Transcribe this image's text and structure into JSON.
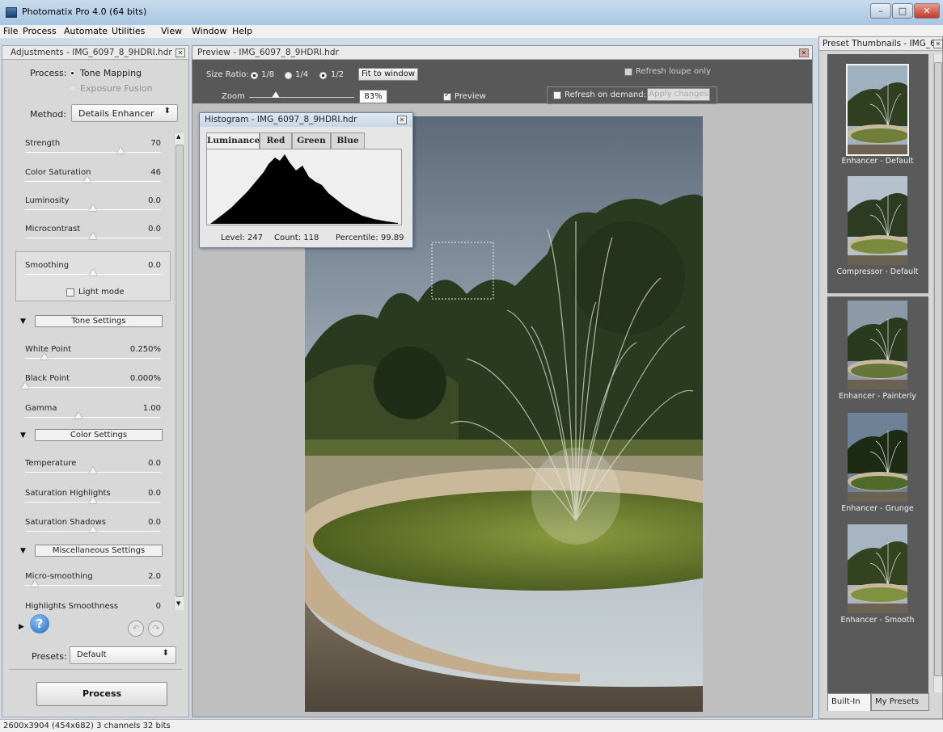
{
  "window": {
    "title": "Photomatix Pro 4.0 (64 bits)",
    "controls": [
      "–",
      "□",
      "✕"
    ]
  },
  "menu": [
    "File",
    "Process",
    "Automate",
    "Utilities",
    "View",
    "Window",
    "Help"
  ],
  "adjustments": {
    "header": "Adjustments - IMG_6097_8_9HDRI.hdr",
    "process_label": "Process:",
    "process_options": [
      "Tone Mapping",
      "Exposure Fusion"
    ],
    "method_label": "Method:",
    "method_value": "Details Enhancer",
    "sliders": [
      {
        "label": "Strength",
        "value": "70",
        "level": 0.7
      },
      {
        "label": "Color Saturation",
        "value": "46",
        "level": 0.46
      },
      {
        "label": "Luminosity",
        "value": "0.0",
        "level": 0.5
      },
      {
        "label": "Microcontrast",
        "value": "0.0",
        "level": 0.5
      },
      {
        "label": "Smoothing",
        "value": "0.0",
        "level": 0.5
      }
    ],
    "light_mode": "Light mode",
    "sections": {
      "tone": {
        "title": "Tone Settings",
        "sliders": [
          {
            "label": "White Point",
            "value": "0.250%",
            "level": 0.14
          },
          {
            "label": "Black Point",
            "value": "0.000%",
            "level": 0.0
          },
          {
            "label": "Gamma",
            "value": "1.00",
            "level": 0.39
          }
        ]
      },
      "color": {
        "title": "Color Settings",
        "sliders": [
          {
            "label": "Temperature",
            "value": "0.0",
            "level": 0.5
          },
          {
            "label": "Saturation Highlights",
            "value": "0.0",
            "level": 0.5
          },
          {
            "label": "Saturation Shadows",
            "value": "0.0",
            "level": 0.5
          }
        ]
      },
      "misc": {
        "title": "Miscellaneous Settings",
        "sliders": [
          {
            "label": "Micro-smoothing",
            "value": "2.0",
            "level": 0.07
          },
          {
            "label": "Highlights Smoothness",
            "value": "0",
            "level": 0.0
          }
        ]
      }
    },
    "presets_label": "Presets:",
    "presets_value": "Default",
    "process_button": "Process"
  },
  "preview": {
    "header": "Preview - IMG_6097_8_9HDRI.hdr",
    "size_ratio_label": "Size Ratio:",
    "size_ratios": [
      "1/8",
      "1/4",
      "1/2"
    ],
    "fit_to_window": "Fit to window",
    "zoom_label": "Zoom",
    "zoom_value": "83%",
    "zoom_level": 0.25,
    "preview_label": "Preview",
    "refresh_loupe": "Refresh loupe only",
    "refresh_on_demand": "Refresh on demand:",
    "apply_changes": "Apply changes"
  },
  "histogram": {
    "title": "Histogram - IMG_6097_8_9HDRI.hdr",
    "tabs": [
      "Luminance",
      "Red",
      "Green",
      "Blue"
    ],
    "level": "Level: 247",
    "count": "Count: 118",
    "percentile": "Percentile: 99.89"
  },
  "presets_panel": {
    "header": "Preset Thumbnails - IMG_6...",
    "thumbs": [
      "Enhancer - Default",
      "Compressor - Default",
      "Enhancer - Painterly",
      "Enhancer - Grunge",
      "Enhancer - Smooth"
    ],
    "tabs": [
      "Built-In",
      "My Presets"
    ]
  },
  "status": "2600x3904 (454x682) 3 channels 32 bits",
  "colors": {
    "tool_bg": "#585858",
    "panel_bg": "#d8d8d8",
    "title_bar": "#b6cfe8"
  }
}
